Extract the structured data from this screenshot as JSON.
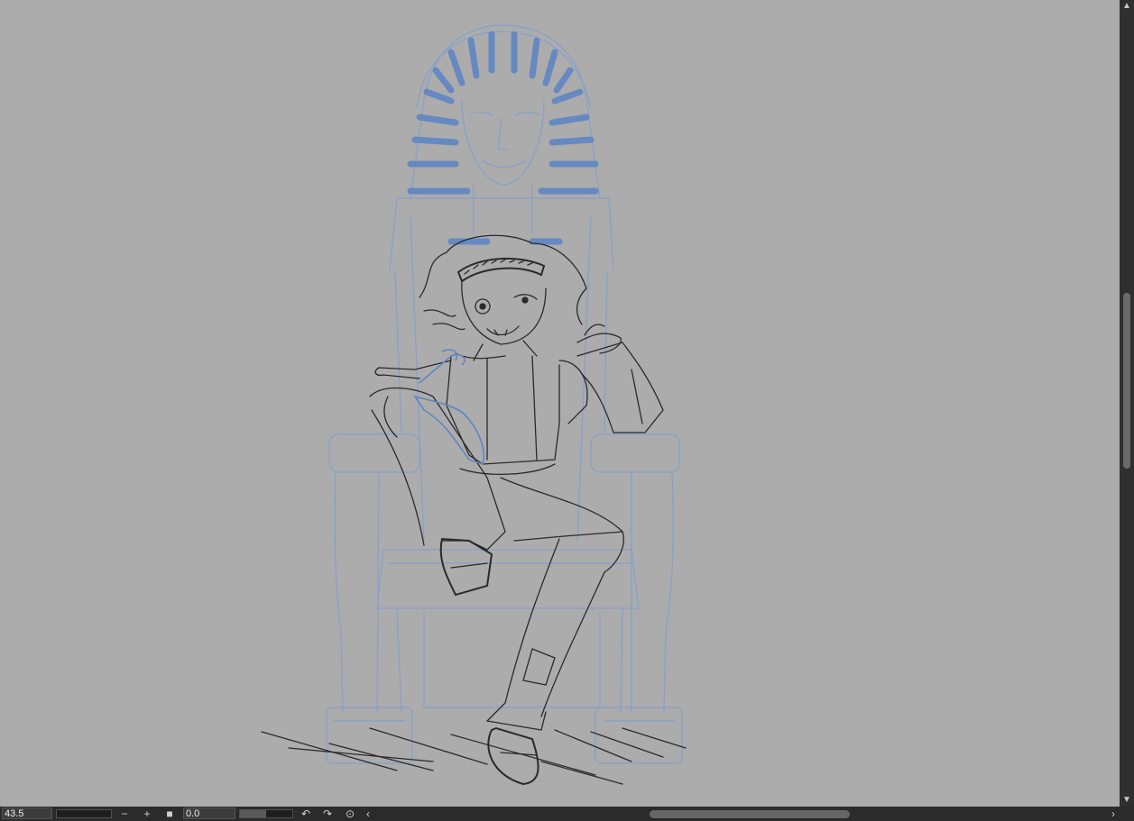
{
  "statusbar": {
    "zoom_value": "43.5",
    "angle_value": "0.0",
    "zoom_out_icon": "minus-icon",
    "zoom_in_icon": "plus-icon",
    "fit_icon": "square-icon",
    "rotate_left_icon": "rotate-left-icon",
    "rotate_right_icon": "rotate-right-icon",
    "reset_icon": "reset-rotation-icon",
    "scroll_left_icon": "chevron-left-icon",
    "scroll_right_icon": "chevron-right-icon"
  },
  "scrollbar": {
    "up_icon": "chevron-up-icon",
    "down_icon": "chevron-down-icon"
  },
  "colors": {
    "canvas": "#acacac",
    "sketch_dark": "#2a2a2a",
    "sketch_blue": "#5f86c4",
    "ui_dark": "#2b2b2b"
  }
}
